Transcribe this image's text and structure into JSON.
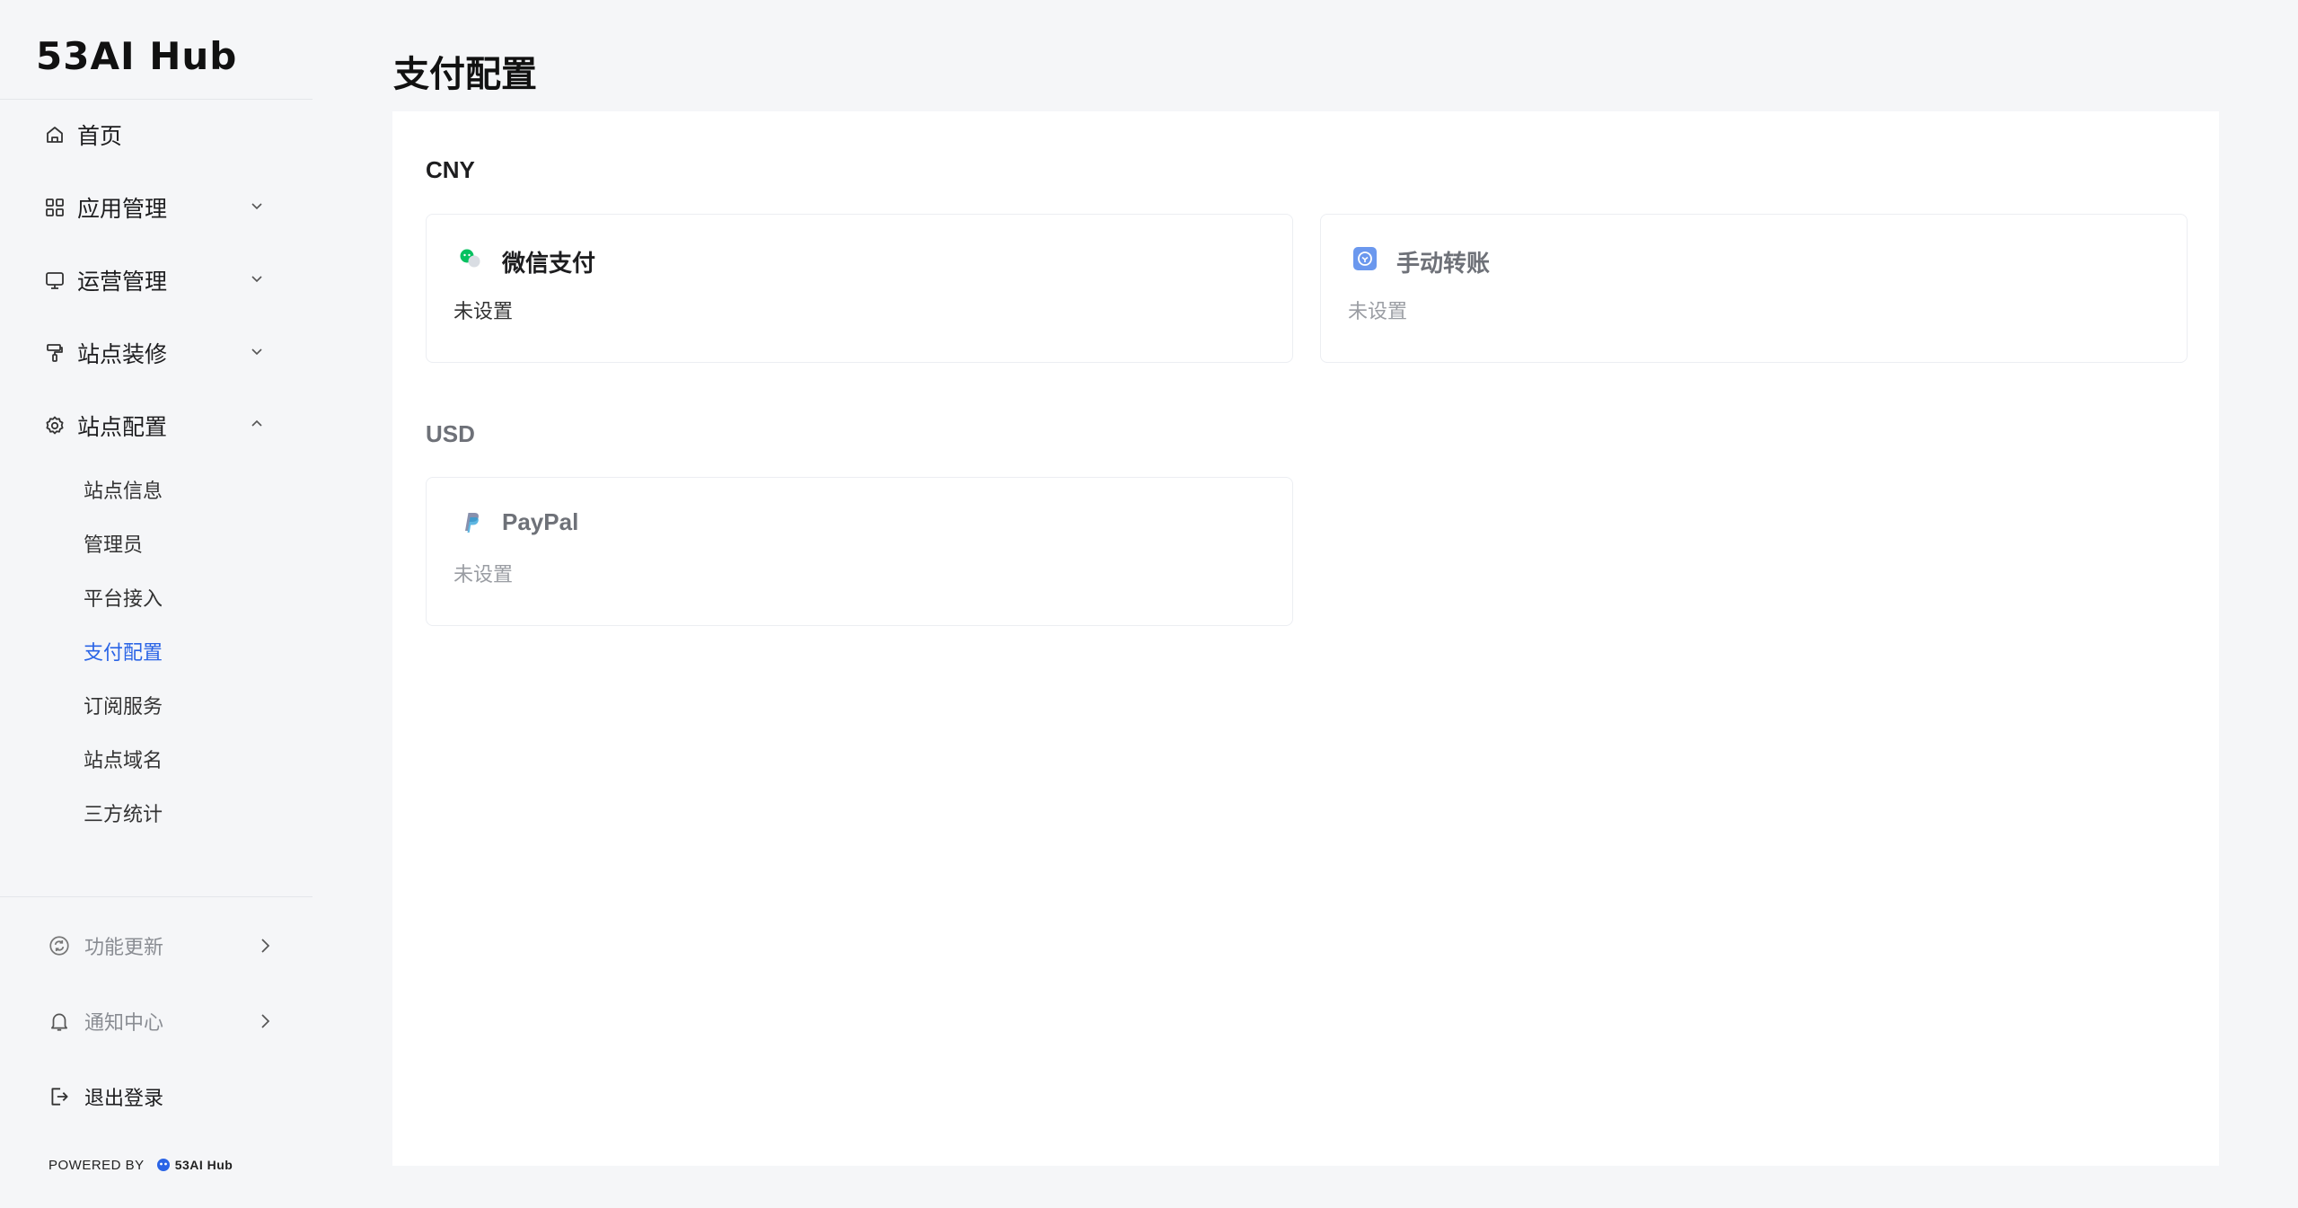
{
  "sidebar": {
    "logo": "53AI Hub",
    "nav": [
      {
        "label": "首页",
        "icon": "home-icon"
      },
      {
        "label": "应用管理",
        "icon": "grid-icon"
      },
      {
        "label": "运营管理",
        "icon": "monitor-icon"
      },
      {
        "label": "站点装修",
        "icon": "paint-roller-icon"
      },
      {
        "label": "站点配置",
        "icon": "gear-icon"
      }
    ],
    "sub_items": [
      "站点信息",
      "管理员",
      "平台接入",
      "支付配置",
      "订阅服务",
      "站点域名",
      "三方统计"
    ],
    "active_sub": "支付配置",
    "bottom": [
      {
        "label": "功能更新",
        "icon": "refresh-icon"
      },
      {
        "label": "通知中心",
        "icon": "bell-icon"
      },
      {
        "label": "退出登录",
        "icon": "logout-icon"
      }
    ],
    "powered_by": "POWERED BY",
    "powered_brand": "53AI Hub"
  },
  "main": {
    "title": "支付配置",
    "sections": [
      {
        "currency": "CNY",
        "cards": [
          {
            "name": "微信支付",
            "status": "未设置",
            "icon": "wechat-pay-icon"
          },
          {
            "name": "手动转账",
            "status": "未设置",
            "icon": "manual-transfer-icon"
          }
        ]
      },
      {
        "currency": "USD",
        "cards": [
          {
            "name": "PayPal",
            "status": "未设置",
            "icon": "paypal-icon"
          }
        ]
      }
    ]
  },
  "colors": {
    "accent": "#2a64e6",
    "wechat_green": "#07c160",
    "manual_blue": "#5b8def"
  }
}
